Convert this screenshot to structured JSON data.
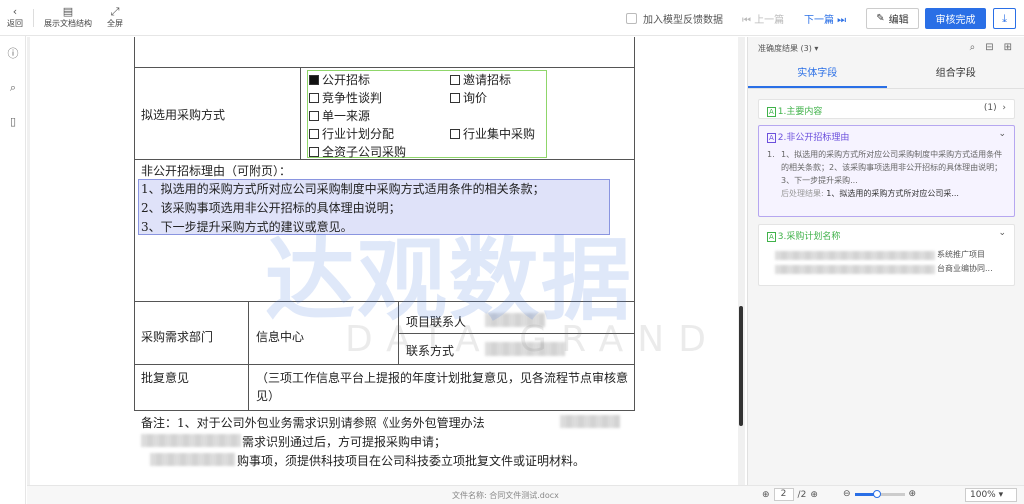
{
  "toolbar": {
    "back_label": "返回",
    "structure_label": "展示文档结构",
    "fullscreen_label": "全屏",
    "feedback_label": "加入模型反馈数据",
    "prev_label": "上一篇",
    "next_label": "下一篇",
    "edit_label": "编辑",
    "done_label": "审核完成"
  },
  "document": {
    "method_label": "拟选用采购方式",
    "options": [
      "公开招标",
      "邀请招标",
      "竞争性谈判",
      "询价",
      "单一来源",
      "行业计划分配",
      "行业集中采购",
      "全资子公司采购"
    ],
    "reason_title": "非公开招标理由（可附页）：",
    "reason_lines": [
      "1、拟选用的采购方式所对应公司采购制度中采购方式适用条件的相关条款；",
      "2、该采购事项选用非公开招标的具体理由说明；",
      "3、下一步提升采购方式的建议或意见。"
    ],
    "dept_label": "采购需求部门",
    "dept_value": "信息中心",
    "contact_label": "项目联系人",
    "phone_label": "联系方式",
    "approval_label": "批复意见",
    "approval_value": "（三项工作信息平台上提报的年度计划批复意见，见各流程节点审核意见）",
    "note_line1_a": "备注：1、对于公司外包业务需求识别请参照《业务外包管理办法",
    "note_line2": "需求识别通过后，方可提报采购申请；",
    "note_line3": "购事项，须提供科技项目在公司科技委立项批复文件或证明材料。"
  },
  "watermark": {
    "cn": "达观数据",
    "en": "DATA GRAND"
  },
  "footer": {
    "filename": "文件名称: 合同文件测试.docx",
    "page_current": "2",
    "page_total": "/2",
    "zoom": "100%"
  },
  "panel": {
    "header": "准确度结果 (3) ▾",
    "tab_entity": "实体字段",
    "tab_combo": "组合字段",
    "cards": [
      {
        "tag": "A",
        "title": "1.主要内容",
        "count": "(1)"
      },
      {
        "tag": "A",
        "title": "2.非公开招标理由",
        "item_num": "1.",
        "body": "1、拟选用的采购方式所对应公司采购制度中采购方式适用条件的相关条款；2、该采购事项选用非公开招标的具体理由说明；3、下一步提升采购...",
        "post_label": "后处理结果:",
        "post_value": "1、拟选用的采购方式所对应公司采..."
      },
      {
        "tag": "A",
        "title": "3.采购计划名称",
        "line1": "系统推广项目",
        "line2": "台商业编协同..."
      }
    ]
  },
  "colors": {
    "accent": "#2a6fe6",
    "green": "#40b24a",
    "purple": "#6b4fdc"
  }
}
